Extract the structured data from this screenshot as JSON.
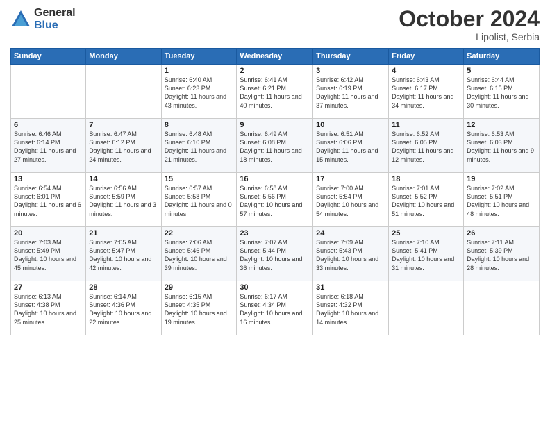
{
  "header": {
    "logo_general": "General",
    "logo_blue": "Blue",
    "month_title": "October 2024",
    "subtitle": "Lipolist, Serbia"
  },
  "weekdays": [
    "Sunday",
    "Monday",
    "Tuesday",
    "Wednesday",
    "Thursday",
    "Friday",
    "Saturday"
  ],
  "weeks": [
    [
      {
        "day": "",
        "info": ""
      },
      {
        "day": "",
        "info": ""
      },
      {
        "day": "1",
        "info": "Sunrise: 6:40 AM\nSunset: 6:23 PM\nDaylight: 11 hours and 43 minutes."
      },
      {
        "day": "2",
        "info": "Sunrise: 6:41 AM\nSunset: 6:21 PM\nDaylight: 11 hours and 40 minutes."
      },
      {
        "day": "3",
        "info": "Sunrise: 6:42 AM\nSunset: 6:19 PM\nDaylight: 11 hours and 37 minutes."
      },
      {
        "day": "4",
        "info": "Sunrise: 6:43 AM\nSunset: 6:17 PM\nDaylight: 11 hours and 34 minutes."
      },
      {
        "day": "5",
        "info": "Sunrise: 6:44 AM\nSunset: 6:15 PM\nDaylight: 11 hours and 30 minutes."
      }
    ],
    [
      {
        "day": "6",
        "info": "Sunrise: 6:46 AM\nSunset: 6:14 PM\nDaylight: 11 hours and 27 minutes."
      },
      {
        "day": "7",
        "info": "Sunrise: 6:47 AM\nSunset: 6:12 PM\nDaylight: 11 hours and 24 minutes."
      },
      {
        "day": "8",
        "info": "Sunrise: 6:48 AM\nSunset: 6:10 PM\nDaylight: 11 hours and 21 minutes."
      },
      {
        "day": "9",
        "info": "Sunrise: 6:49 AM\nSunset: 6:08 PM\nDaylight: 11 hours and 18 minutes."
      },
      {
        "day": "10",
        "info": "Sunrise: 6:51 AM\nSunset: 6:06 PM\nDaylight: 11 hours and 15 minutes."
      },
      {
        "day": "11",
        "info": "Sunrise: 6:52 AM\nSunset: 6:05 PM\nDaylight: 11 hours and 12 minutes."
      },
      {
        "day": "12",
        "info": "Sunrise: 6:53 AM\nSunset: 6:03 PM\nDaylight: 11 hours and 9 minutes."
      }
    ],
    [
      {
        "day": "13",
        "info": "Sunrise: 6:54 AM\nSunset: 6:01 PM\nDaylight: 11 hours and 6 minutes."
      },
      {
        "day": "14",
        "info": "Sunrise: 6:56 AM\nSunset: 5:59 PM\nDaylight: 11 hours and 3 minutes."
      },
      {
        "day": "15",
        "info": "Sunrise: 6:57 AM\nSunset: 5:58 PM\nDaylight: 11 hours and 0 minutes."
      },
      {
        "day": "16",
        "info": "Sunrise: 6:58 AM\nSunset: 5:56 PM\nDaylight: 10 hours and 57 minutes."
      },
      {
        "day": "17",
        "info": "Sunrise: 7:00 AM\nSunset: 5:54 PM\nDaylight: 10 hours and 54 minutes."
      },
      {
        "day": "18",
        "info": "Sunrise: 7:01 AM\nSunset: 5:52 PM\nDaylight: 10 hours and 51 minutes."
      },
      {
        "day": "19",
        "info": "Sunrise: 7:02 AM\nSunset: 5:51 PM\nDaylight: 10 hours and 48 minutes."
      }
    ],
    [
      {
        "day": "20",
        "info": "Sunrise: 7:03 AM\nSunset: 5:49 PM\nDaylight: 10 hours and 45 minutes."
      },
      {
        "day": "21",
        "info": "Sunrise: 7:05 AM\nSunset: 5:47 PM\nDaylight: 10 hours and 42 minutes."
      },
      {
        "day": "22",
        "info": "Sunrise: 7:06 AM\nSunset: 5:46 PM\nDaylight: 10 hours and 39 minutes."
      },
      {
        "day": "23",
        "info": "Sunrise: 7:07 AM\nSunset: 5:44 PM\nDaylight: 10 hours and 36 minutes."
      },
      {
        "day": "24",
        "info": "Sunrise: 7:09 AM\nSunset: 5:43 PM\nDaylight: 10 hours and 33 minutes."
      },
      {
        "day": "25",
        "info": "Sunrise: 7:10 AM\nSunset: 5:41 PM\nDaylight: 10 hours and 31 minutes."
      },
      {
        "day": "26",
        "info": "Sunrise: 7:11 AM\nSunset: 5:39 PM\nDaylight: 10 hours and 28 minutes."
      }
    ],
    [
      {
        "day": "27",
        "info": "Sunrise: 6:13 AM\nSunset: 4:38 PM\nDaylight: 10 hours and 25 minutes."
      },
      {
        "day": "28",
        "info": "Sunrise: 6:14 AM\nSunset: 4:36 PM\nDaylight: 10 hours and 22 minutes."
      },
      {
        "day": "29",
        "info": "Sunrise: 6:15 AM\nSunset: 4:35 PM\nDaylight: 10 hours and 19 minutes."
      },
      {
        "day": "30",
        "info": "Sunrise: 6:17 AM\nSunset: 4:34 PM\nDaylight: 10 hours and 16 minutes."
      },
      {
        "day": "31",
        "info": "Sunrise: 6:18 AM\nSunset: 4:32 PM\nDaylight: 10 hours and 14 minutes."
      },
      {
        "day": "",
        "info": ""
      },
      {
        "day": "",
        "info": ""
      }
    ]
  ]
}
